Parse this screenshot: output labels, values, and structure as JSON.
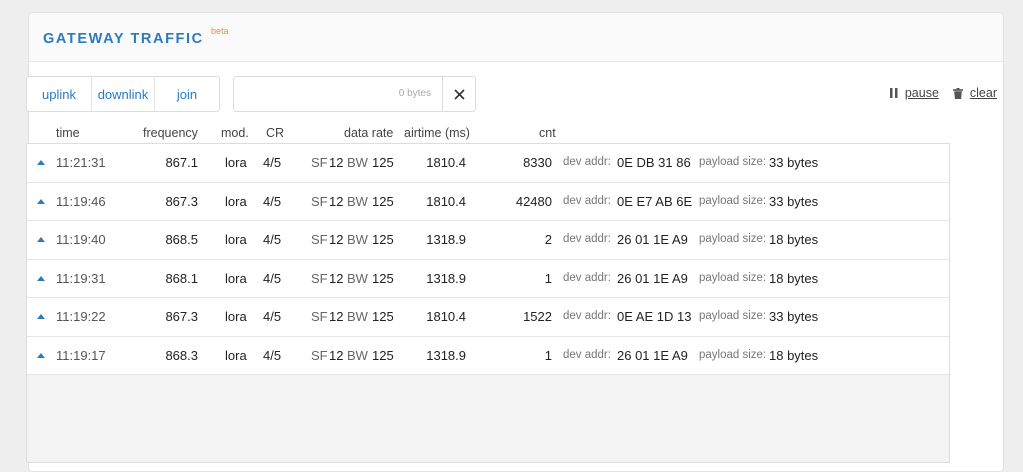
{
  "header": {
    "title": "GATEWAY TRAFFIC",
    "badge": "beta"
  },
  "filters": {
    "uplink": "uplink",
    "downlink": "downlink",
    "join": "join"
  },
  "search": {
    "value": "",
    "placeholder": "",
    "size_label": "0 bytes"
  },
  "actions": {
    "pause": "pause",
    "clear": "clear"
  },
  "columns": {
    "time": "time",
    "frequency": "frequency",
    "mod": "mod.",
    "cr": "CR",
    "data_rate": "data rate",
    "airtime": "airtime (ms)",
    "cnt": "cnt"
  },
  "labels": {
    "sf": "SF",
    "bw": "BW",
    "dev_addr": "dev addr:",
    "payload_size": "payload size:"
  },
  "rows": [
    {
      "direction": "uplink",
      "time": "11:21:31",
      "frequency": "867.1",
      "mod": "lora",
      "cr": "4/5",
      "sf": "12",
      "bw": "125",
      "airtime": "1810.4",
      "cnt": "8330",
      "dev_addr": "0E DB 31 86",
      "payload": "33 bytes"
    },
    {
      "direction": "uplink",
      "time": "11:19:46",
      "frequency": "867.3",
      "mod": "lora",
      "cr": "4/5",
      "sf": "12",
      "bw": "125",
      "airtime": "1810.4",
      "cnt": "42480",
      "dev_addr": "0E E7 AB 6E",
      "payload": "33 bytes"
    },
    {
      "direction": "uplink",
      "time": "11:19:40",
      "frequency": "868.5",
      "mod": "lora",
      "cr": "4/5",
      "sf": "12",
      "bw": "125",
      "airtime": "1318.9",
      "cnt": "2",
      "dev_addr": "26 01 1E A9",
      "payload": "18 bytes"
    },
    {
      "direction": "uplink",
      "time": "11:19:31",
      "frequency": "868.1",
      "mod": "lora",
      "cr": "4/5",
      "sf": "12",
      "bw": "125",
      "airtime": "1318.9",
      "cnt": "1",
      "dev_addr": "26 01 1E A9",
      "payload": "18 bytes"
    },
    {
      "direction": "uplink",
      "time": "11:19:22",
      "frequency": "867.3",
      "mod": "lora",
      "cr": "4/5",
      "sf": "12",
      "bw": "125",
      "airtime": "1810.4",
      "cnt": "1522",
      "dev_addr": "0E AE 1D 13",
      "payload": "33 bytes"
    },
    {
      "direction": "uplink",
      "time": "11:19:17",
      "frequency": "868.3",
      "mod": "lora",
      "cr": "4/5",
      "sf": "12",
      "bw": "125",
      "airtime": "1318.9",
      "cnt": "1",
      "dev_addr": "26 01 1E A9",
      "payload": "18 bytes"
    }
  ],
  "colors": {
    "accent": "#2b7bbf",
    "badge": "#e8913a"
  }
}
